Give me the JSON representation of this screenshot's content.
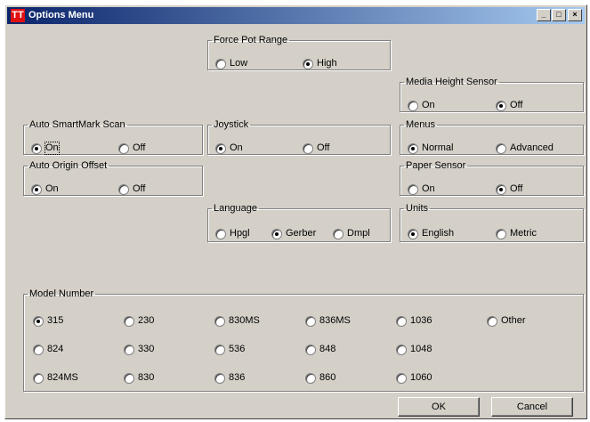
{
  "window": {
    "title": "Options Menu",
    "icon_text": "TT",
    "minimize": "_",
    "maximize": "□",
    "close": "×"
  },
  "groups": {
    "force_pot_range": {
      "label": "Force Pot Range",
      "options": [
        "Low",
        "High"
      ],
      "selected": "High"
    },
    "media_height_sensor": {
      "label": "Media Height Sensor",
      "options": [
        "On",
        "Off"
      ],
      "selected": "Off"
    },
    "auto_smartmark_scan": {
      "label": "Auto SmartMark Scan",
      "options": [
        "On",
        "Off"
      ],
      "selected": "On"
    },
    "joystick": {
      "label": "Joystick",
      "options": [
        "On",
        "Off"
      ],
      "selected": "On"
    },
    "menus": {
      "label": "Menus",
      "options": [
        "Normal",
        "Advanced"
      ],
      "selected": "Normal"
    },
    "auto_origin_offset": {
      "label": "Auto Origin Offset",
      "options": [
        "On",
        "Off"
      ],
      "selected": "On"
    },
    "paper_sensor": {
      "label": "Paper Sensor",
      "options": [
        "On",
        "Off"
      ],
      "selected": "Off"
    },
    "language": {
      "label": "Language",
      "options": [
        "Hpgl",
        "Gerber",
        "Dmpl"
      ],
      "selected": "Gerber"
    },
    "units": {
      "label": "Units",
      "options": [
        "English",
        "Metric"
      ],
      "selected": "English"
    },
    "model_number": {
      "label": "Model Number",
      "options": [
        "315",
        "230",
        "830MS",
        "836MS",
        "1036",
        "Other",
        "824",
        "330",
        "536",
        "848",
        "1048",
        "824MS",
        "830",
        "836",
        "860",
        "1060"
      ],
      "selected": "315"
    }
  },
  "buttons": {
    "ok": "OK",
    "cancel": "Cancel"
  }
}
